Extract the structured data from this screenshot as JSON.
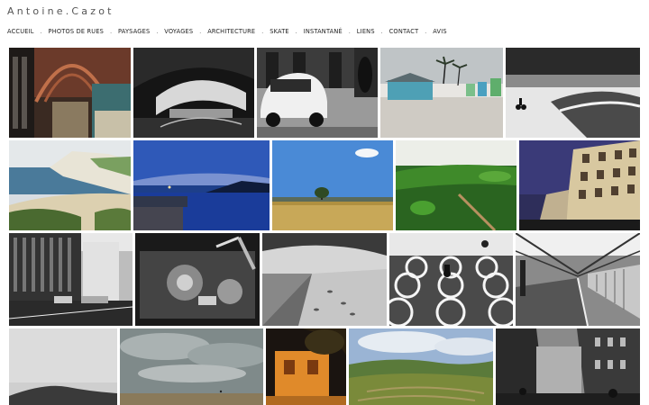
{
  "site": {
    "title": "Antoine.Cazot"
  },
  "nav": {
    "separator": ".",
    "items": [
      "ACCUEIL",
      "PHOTOS DE RUES",
      "PAYSAGES",
      "VOYAGES",
      "ARCHITECTURE",
      "SKATE",
      "INSTANTANÉ",
      "LIENS",
      "CONTACT",
      "AVIS"
    ]
  },
  "gallery": {
    "tiles": [
      {
        "subject": "gare-arches-interior"
      },
      {
        "subject": "bridge-underside-bw"
      },
      {
        "subject": "fiat-500-street-bw"
      },
      {
        "subject": "beach-huts-palms"
      },
      {
        "subject": "cyclist-beach-bw"
      },
      {
        "subject": "cliff-coast-beach"
      },
      {
        "subject": "harbor-dusk-blue"
      },
      {
        "subject": "lone-tree-wheat-field"
      },
      {
        "subject": "green-valley-path"
      },
      {
        "subject": "haussmann-building-night"
      },
      {
        "subject": "street-buildings-bw"
      },
      {
        "subject": "turntable-closeup-bw"
      },
      {
        "subject": "sand-footprints-bw"
      },
      {
        "subject": "cyclist-circles-bw"
      },
      {
        "subject": "train-station-platform-bw"
      },
      {
        "subject": "hill-grey-sky-bw"
      },
      {
        "subject": "grey-clouds-beach"
      },
      {
        "subject": "orange-facade-tree"
      },
      {
        "subject": "vineyard-hills"
      },
      {
        "subject": "paris-street-bw"
      }
    ]
  }
}
